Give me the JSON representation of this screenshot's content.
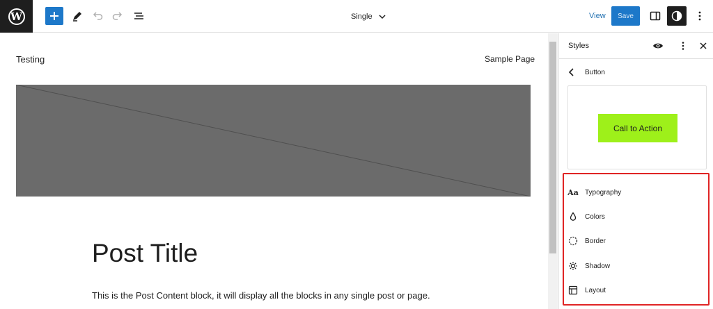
{
  "toolbar": {
    "logo_letter": "W",
    "document_title": "Single",
    "view_label": "View",
    "save_label": "Save"
  },
  "canvas": {
    "site_title": "Testing",
    "nav_link": "Sample Page",
    "post_title": "Post Title",
    "post_content": "This is the Post Content block, it will display all the blocks in any single post or page."
  },
  "sidebar": {
    "title": "Styles",
    "back_label": "Button",
    "preview_button_label": "Call to Action",
    "menu": [
      {
        "icon": "typography-icon",
        "label": "Typography",
        "icon_text": "Aa"
      },
      {
        "icon": "colors-icon",
        "label": "Colors"
      },
      {
        "icon": "border-icon",
        "label": "Border"
      },
      {
        "icon": "shadow-icon",
        "label": "Shadow"
      },
      {
        "icon": "layout-icon",
        "label": "Layout"
      }
    ]
  },
  "colors": {
    "accent": "#1d78c9",
    "cta_background": "#9ef01a",
    "highlight": "#e02424",
    "image_placeholder": "#6b6b6b"
  }
}
